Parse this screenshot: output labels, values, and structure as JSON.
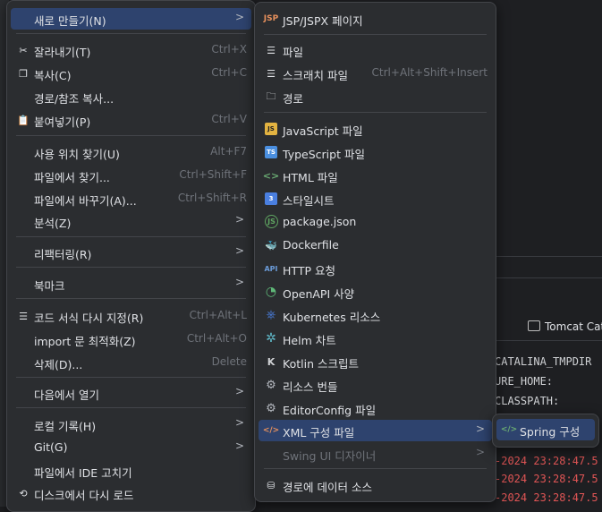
{
  "background": {
    "tab_label": "Tomcat Cat",
    "logs": [
      {
        "text": "CATALINA_TMPDIR",
        "color": "#cfd1d4"
      },
      {
        "text": "URE_HOME:",
        "color": "#cfd1d4"
      },
      {
        "text": "CLASSPATH:",
        "color": "#cfd1d4"
      },
      {
        "text": "-2024 23:28:47.5",
        "color": "#e05555"
      },
      {
        "text": "-2024 23:28:47.5",
        "color": "#e05555"
      },
      {
        "text": "-2024 23:28:47.5",
        "color": "#e05555"
      }
    ]
  },
  "context_menu": {
    "items": [
      {
        "label": "새로 만들기(N)",
        "submenu": true,
        "selected": true
      },
      {
        "label": "잘라내기(T)",
        "shortcut": "Ctrl+X",
        "icon": "scissors-icon"
      },
      {
        "label": "복사(C)",
        "shortcut": "Ctrl+C",
        "icon": "copy-icon"
      },
      {
        "label": "경로/참조 복사..."
      },
      {
        "label": "붙여넣기(P)",
        "shortcut": "Ctrl+V",
        "icon": "paste-icon"
      },
      {
        "label": "사용 위치 찾기(U)",
        "shortcut": "Alt+F7"
      },
      {
        "label": "파일에서 찾기...",
        "shortcut": "Ctrl+Shift+F"
      },
      {
        "label": "파일에서 바꾸기(A)...",
        "shortcut": "Ctrl+Shift+R"
      },
      {
        "label": "분석(Z)",
        "submenu": true
      },
      {
        "label": "리팩터링(R)",
        "submenu": true
      },
      {
        "label": "북마크",
        "submenu": true
      },
      {
        "label": "코드 서식 다시 지정(R)",
        "shortcut": "Ctrl+Alt+L",
        "icon": "reformat-icon"
      },
      {
        "label": "import 문 최적화(Z)",
        "shortcut": "Ctrl+Alt+O"
      },
      {
        "label": "삭제(D)...",
        "shortcut": "Delete"
      },
      {
        "label": "다음에서 열기",
        "submenu": true
      },
      {
        "label": "로컬 기록(H)",
        "submenu": true
      },
      {
        "label": "Git(G)",
        "submenu": true
      },
      {
        "label": "파일에서 IDE 고치기"
      },
      {
        "label": "디스크에서 다시 로드",
        "icon": "reload-icon"
      }
    ]
  },
  "new_submenu": {
    "items": [
      {
        "label": "JSP/JSPX 페이지",
        "icon_text": "JSP",
        "icon_color": "#e8915d"
      },
      {
        "label": "파일",
        "icon": "file-icon"
      },
      {
        "label": "스크래치 파일",
        "shortcut": "Ctrl+Alt+Shift+Insert",
        "icon": "scratch-file-icon"
      },
      {
        "label": "경로",
        "icon": "folder-icon"
      },
      {
        "label": "JavaScript 파일",
        "icon_text": "JS",
        "icon_color": "#e3b341"
      },
      {
        "label": "TypeScript 파일",
        "icon_text": "TS",
        "icon_color": "#4a8fe0"
      },
      {
        "label": "HTML 파일",
        "icon_text": "<>",
        "icon_color": "#6aab73"
      },
      {
        "label": "스타일시트",
        "icon_text": "3",
        "icon_color": "#4a7fe0"
      },
      {
        "label": "package.json",
        "icon_text": "JS",
        "icon_color": "#5fa561"
      },
      {
        "label": "Dockerfile",
        "icon_text": "🐳",
        "icon_color": "#4a8fe0"
      },
      {
        "label": "HTTP 요청",
        "icon_text": "API",
        "icon_color": "#6b9bd8"
      },
      {
        "label": "OpenAPI 사양",
        "icon_text": "◔",
        "icon_color": "#5fb878"
      },
      {
        "label": "Kubernetes 리소스",
        "icon_text": "⎈",
        "icon_color": "#4a7fe0"
      },
      {
        "label": "Helm 차트",
        "icon_text": "✲",
        "icon_color": "#5fb8c8"
      },
      {
        "label": "Kotlin 스크립트",
        "icon_text": "K",
        "icon_color": "#cfd1d4"
      },
      {
        "label": "리소스 번들",
        "icon_text": "⚙",
        "icon_color": "#b4b8bf"
      },
      {
        "label": "EditorConfig 파일",
        "icon_text": "⚙",
        "icon_color": "#b4b8bf"
      },
      {
        "label": "XML 구성 파일",
        "submenu": true,
        "selected": true,
        "icon_text": "</>",
        "icon_color": "#e8915d"
      },
      {
        "label": "Swing UI 디자이너",
        "submenu": true,
        "disabled": true
      },
      {
        "label": "경로에 데이터 소스",
        "icon": "database-icon"
      }
    ]
  },
  "xml_submenu": {
    "items": [
      {
        "label": "Spring 구성",
        "selected": true,
        "icon_text": "</>",
        "icon_color": "#6aab73"
      }
    ]
  }
}
